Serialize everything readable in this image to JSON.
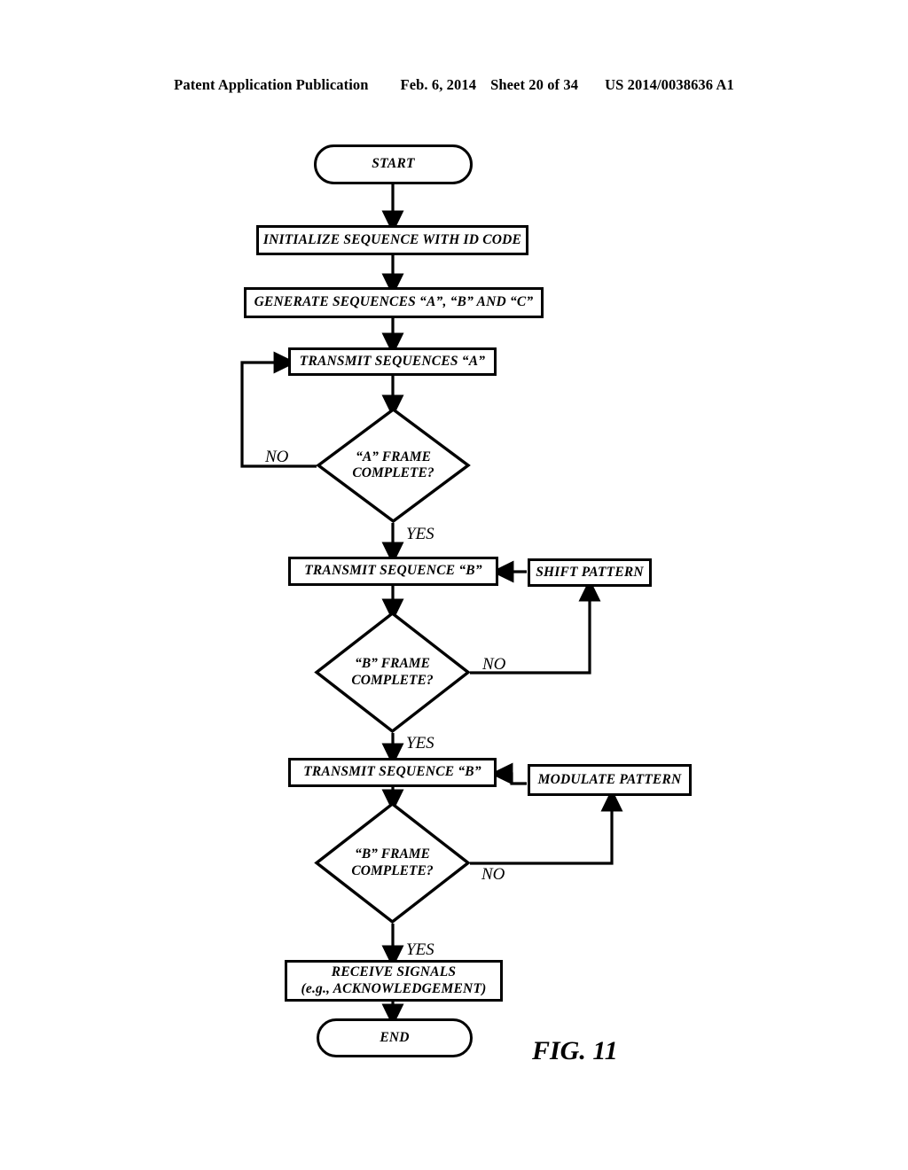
{
  "header": {
    "publication": "Patent Application Publication",
    "date": "Feb. 6, 2014",
    "sheet": "Sheet 20 of 34",
    "patent_number": "US 2014/0038636 A1"
  },
  "figure": {
    "caption": "FIG. 11",
    "nodes": {
      "start": "START",
      "initialize": "INITIALIZE SEQUENCE WITH ID CODE",
      "generate": "GENERATE SEQUENCES “A”, “B” AND “C”",
      "transmit_a": "TRANSMIT SEQUENCES “A”",
      "decision_a": "“A” FRAME COMPLETE?",
      "decision_a_line1": "“A” FRAME",
      "decision_a_line2": "COMPLETE?",
      "transmit_b1": "TRANSMIT SEQUENCE “B”",
      "shift_pattern": "SHIFT PATTERN",
      "decision_b1_line1": "“B” FRAME",
      "decision_b1_line2": "COMPLETE?",
      "transmit_b2": "TRANSMIT SEQUENCE “B”",
      "modulate_pattern": "MODULATE PATTERN",
      "decision_b2_line1": "“B” FRAME",
      "decision_b2_line2": "COMPLETE?",
      "receive_line1": "RECEIVE SIGNALS",
      "receive_line2": "(e.g., ACKNOWLEDGEMENT)",
      "end": "END"
    },
    "edge_labels": {
      "no_a": "NO",
      "yes_a": "YES",
      "no_b1": "NO",
      "yes_b1": "YES",
      "no_b2": "NO",
      "yes_b2": "YES"
    },
    "colors": {
      "stroke": "#000000",
      "fill": "#ffffff",
      "page_background": "#ffffff"
    }
  }
}
